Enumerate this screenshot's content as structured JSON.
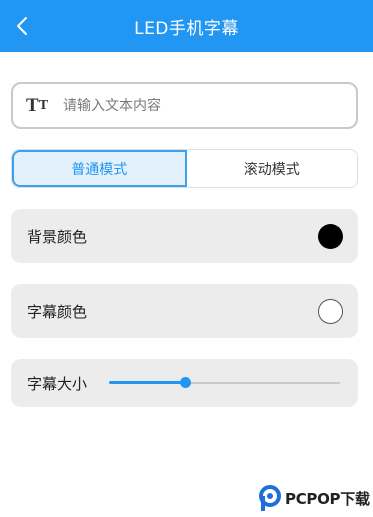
{
  "header": {
    "title": "LED手机字幕",
    "back_icon": "chevron-left-icon"
  },
  "text_input": {
    "placeholder": "请输入文本内容",
    "value": "",
    "icon": "text-size-icon",
    "icon_glyph_big": "T",
    "icon_glyph_small": "T"
  },
  "modes": {
    "items": [
      {
        "label": "普通模式",
        "active": true
      },
      {
        "label": "滚动模式",
        "active": false
      }
    ]
  },
  "background_color": {
    "label": "背景颜色",
    "value": "#000000"
  },
  "text_color": {
    "label": "字幕颜色",
    "value": "#ffffff"
  },
  "text_size": {
    "label": "字幕大小",
    "level": 0.33
  },
  "colors": {
    "accent": "#2196f3",
    "row_bg": "#ececec"
  },
  "watermark": {
    "logo_text": "PCPOP",
    "suffix": "下载"
  }
}
